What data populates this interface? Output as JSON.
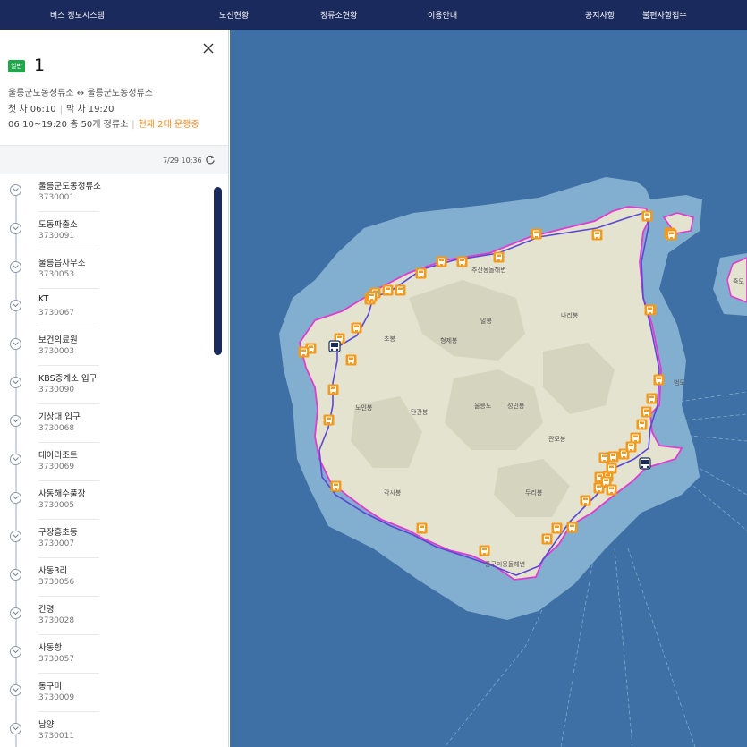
{
  "nav": {
    "brand": "버스 정보시스템",
    "items": [
      "노선현황",
      "정류소현황",
      "이용안내",
      "공지사항",
      "불편사항접수"
    ]
  },
  "route": {
    "badge": "일반",
    "number": "1",
    "endpoints": "울릉군도동정류소 ↔ 울릉군도동정류소",
    "first_bus": "첫 차 06:10",
    "last_bus": "막 차 19:20",
    "summary": "06:10~19:20 총 50개 정류소",
    "running": "현재 2대 운행중",
    "updated": "7/29 10:36"
  },
  "stops": [
    {
      "name": "울릉군도동정류소",
      "code": "3730001"
    },
    {
      "name": "도동파출소",
      "code": "3730091"
    },
    {
      "name": "울릉읍사무소",
      "code": "3730053"
    },
    {
      "name": "KT",
      "code": "3730067"
    },
    {
      "name": "보건의료원",
      "code": "3730003"
    },
    {
      "name": "KBS중계소 입구",
      "code": "3730090"
    },
    {
      "name": "기상대 입구",
      "code": "3730068"
    },
    {
      "name": "대아리조트",
      "code": "3730069"
    },
    {
      "name": "사동해수풀장",
      "code": "3730005"
    },
    {
      "name": "구장흥초등",
      "code": "3730007"
    },
    {
      "name": "사동3리",
      "code": "3730056"
    },
    {
      "name": "간령",
      "code": "3730028"
    },
    {
      "name": "사동항",
      "code": "3730057"
    },
    {
      "name": "통구미",
      "code": "3730009"
    },
    {
      "name": "남양",
      "code": "3730011"
    }
  ],
  "map": {
    "labels": [
      {
        "text": "추산몽돌해변"
      },
      {
        "text": "말봉"
      },
      {
        "text": "나리봉"
      },
      {
        "text": "초봉"
      },
      {
        "text": "형제봉"
      },
      {
        "text": "노인봉"
      },
      {
        "text": "탄간봉"
      },
      {
        "text": "울릉도"
      },
      {
        "text": "성인봉"
      },
      {
        "text": "관모봉"
      },
      {
        "text": "두리봉"
      },
      {
        "text": "각시봉"
      },
      {
        "text": "통구미몽돌해변"
      },
      {
        "text": "죽도"
      },
      {
        "text": "범도"
      }
    ]
  },
  "colors": {
    "nav": "#1b2a5c",
    "badge": "#1ea84a",
    "running": "#f08c1e",
    "route": "#e03ccf",
    "stop_marker": "#f39a1c",
    "sea": "#3f70a5",
    "shallow": "#82aed0",
    "land": "#e4e3cf"
  }
}
